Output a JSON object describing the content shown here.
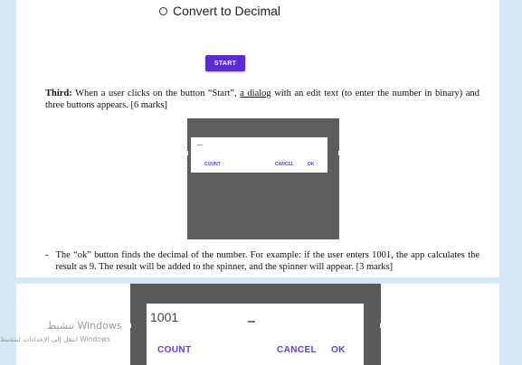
{
  "radio_option": {
    "label": "Convert to Decimal"
  },
  "start_button": {
    "label": "START"
  },
  "third": {
    "bold": "Third:",
    "text1": " When a user clicks on the button “Start”, ",
    "underline": "a dialog",
    "text2": " with an edit text (to enter the number in binary) and three buttons appears. [6 marks]"
  },
  "dialog_small": {
    "count": "COUNT",
    "cancel": "CANCEL",
    "ok": "OK"
  },
  "bullet": {
    "marker": "-",
    "text": "The “ok” button finds the decimal of the number. For example: if the user enters 1001, the app calculates the result as 9. The result will be added to the spinner, and the spinner will appear. [3 marks]"
  },
  "dialog_large": {
    "value": "1001",
    "count": "COUNT",
    "cancel": "CANCEL",
    "ok": "OK"
  },
  "watermark": {
    "line1": "تنشيط Windows",
    "line2": "انتقل إلى الإعدادات لتنشيط Windows"
  }
}
